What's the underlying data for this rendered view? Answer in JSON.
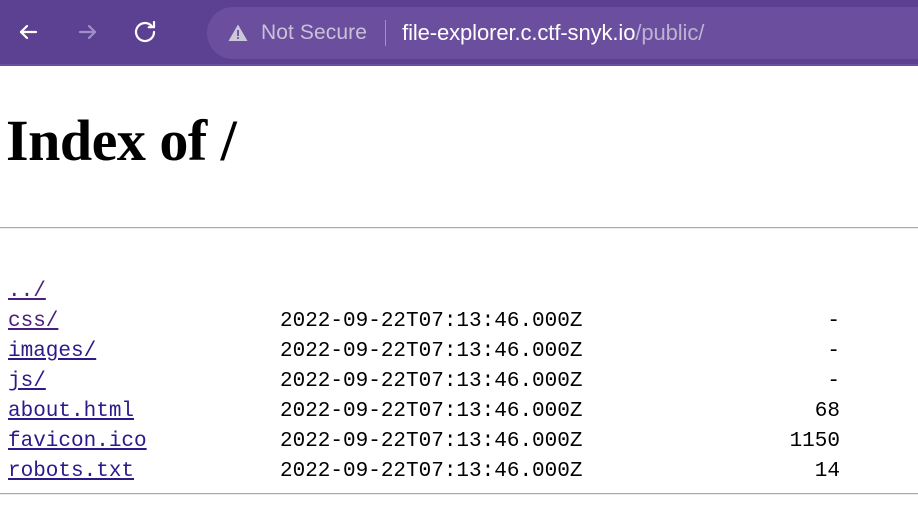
{
  "browser": {
    "back_label": "Back",
    "forward_label": "Forward",
    "reload_label": "Reload",
    "security_label": "Not Secure",
    "url_host": "file-explorer.c.ctf-snyk.io",
    "url_path": "/public/",
    "toolbar_color": "#5c4091",
    "url_pill_color": "#6b4f9e"
  },
  "page": {
    "title": "Index of /",
    "link_color": "#2b1a8a",
    "visited_link_color": "#4b1f7d",
    "entries": [
      {
        "name": "../",
        "date": "",
        "size": "",
        "visited": true
      },
      {
        "name": "css/",
        "date": "2022-09-22T07:13:46.000Z",
        "size": "-",
        "visited": true
      },
      {
        "name": "images/",
        "date": "2022-09-22T07:13:46.000Z",
        "size": "-",
        "visited": false
      },
      {
        "name": "js/",
        "date": "2022-09-22T07:13:46.000Z",
        "size": "-",
        "visited": false
      },
      {
        "name": "about.html",
        "date": "2022-09-22T07:13:46.000Z",
        "size": "68",
        "visited": false
      },
      {
        "name": "favicon.ico",
        "date": "2022-09-22T07:13:46.000Z",
        "size": "1150",
        "visited": false
      },
      {
        "name": "robots.txt",
        "date": "2022-09-22T07:13:46.000Z",
        "size": "14",
        "visited": false
      }
    ]
  }
}
